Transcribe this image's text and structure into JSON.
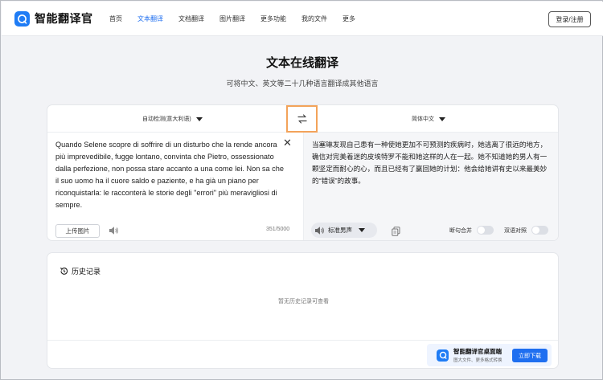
{
  "app": {
    "name": "智能翻译官"
  },
  "nav": {
    "items": [
      {
        "label": "首页",
        "active": false
      },
      {
        "label": "文本翻译",
        "active": true
      },
      {
        "label": "文档翻译",
        "active": false
      },
      {
        "label": "图片翻译",
        "active": false
      },
      {
        "label": "更多功能",
        "active": false
      },
      {
        "label": "我的文件",
        "active": false
      },
      {
        "label": "更多",
        "active": false
      }
    ],
    "login_label": "登录/注册"
  },
  "hero": {
    "title": "文本在线翻译",
    "subtitle": "可将中文、英文等二十几种语言翻译成其他语言"
  },
  "translator": {
    "source_language": "自动检测(意大利语)",
    "target_language": "简体中文",
    "source_text": "Quando Selene scopre di soffrire di un disturbo che la rende ancora più imprevedibile, fugge lontano, convinta che Pietro, ossessionato dalla perfezione, non possa stare accanto a una come lei. Non sa che il suo uomo ha il cuore saldo e paziente, e ha già un piano per riconquistarla: le racconterà le storie degli \"errori\" più meravigliosi di sempre.",
    "clear_symbol": "✕",
    "upload_label": "上传图片",
    "char_count": "351/5000",
    "translated_text": "当塞琳发现自己患有一种使她更加不可预测的疾病时，她逃离了很远的地方，确信对完美着迷的皮埃特罗不能和她这样的人在一起。她不知道她的男人有一颗坚定而耐心的心，而且已经有了赢回她的计划：他会给她讲有史以来最美妙的“错误”的故事。",
    "voice_label": "标准男声",
    "toggle_sentence_merge": "断句合并",
    "toggle_bilingual": "双语对照"
  },
  "history": {
    "title": "历史记录",
    "empty_text": "暂无历史记录可查看"
  },
  "promo": {
    "title": "智能翻译官桌面端",
    "subtitle": "图大文件、更多格式转换",
    "button_label": "立即下载"
  },
  "colors": {
    "accent": "#1f6ff0",
    "swap_highlight": "#f3a35a",
    "page_bg": "#f2f3f6"
  }
}
